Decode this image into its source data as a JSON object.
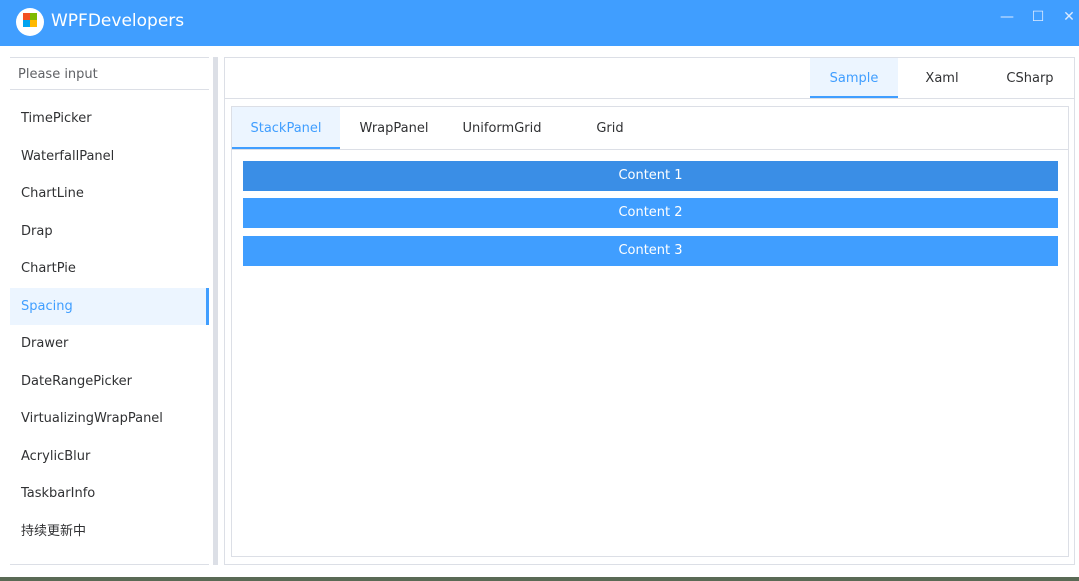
{
  "window": {
    "title": "WPFDevelopers",
    "logo_text": "WPF",
    "minimize": "—",
    "maximize": "☐",
    "close": "✕"
  },
  "sidebar": {
    "search_placeholder": "Please input",
    "items": [
      {
        "label": "TimePicker"
      },
      {
        "label": "WaterfallPanel"
      },
      {
        "label": "ChartLine"
      },
      {
        "label": "Drap"
      },
      {
        "label": "ChartPie"
      },
      {
        "label": "Spacing",
        "active": true
      },
      {
        "label": "Drawer"
      },
      {
        "label": "DateRangePicker"
      },
      {
        "label": "VirtualizingWrapPanel"
      },
      {
        "label": "AcrylicBlur"
      },
      {
        "label": "TaskbarInfo"
      },
      {
        "label": "持续更新中"
      }
    ]
  },
  "top_tabs": [
    {
      "label": "Sample",
      "active": true
    },
    {
      "label": "Xaml"
    },
    {
      "label": "CSharp"
    }
  ],
  "inner_tabs": [
    {
      "label": "StackPanel",
      "active": true
    },
    {
      "label": "WrapPanel"
    },
    {
      "label": "UniformGrid"
    },
    {
      "label": "Grid"
    }
  ],
  "contents": [
    "Content 1",
    "Content 2",
    "Content 3"
  ],
  "colors": {
    "accent": "#409EFF",
    "accent_dark": "#3A8EE6"
  }
}
